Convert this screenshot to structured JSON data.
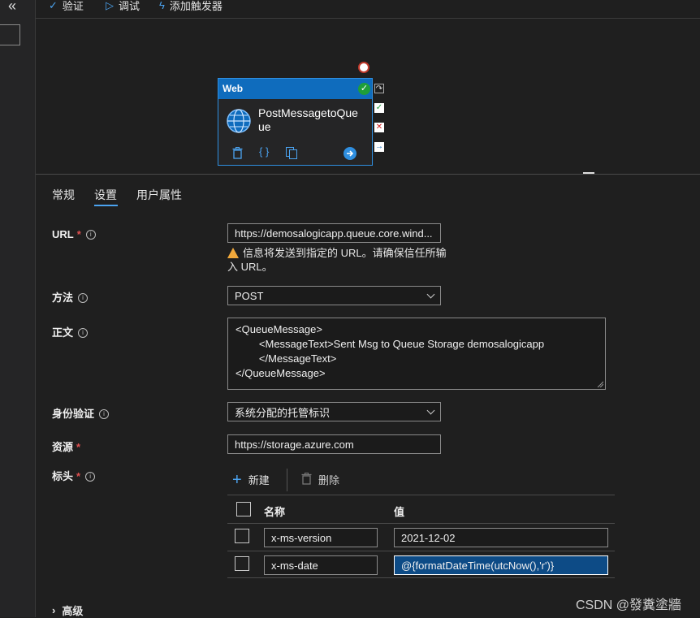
{
  "toolbar": {
    "validate": "验证",
    "debug": "调试",
    "add_trigger": "添加触发器"
  },
  "node": {
    "type": "Web",
    "title": "PostMessagetoQueue"
  },
  "tabs": [
    "常规",
    "设置",
    "用户属性"
  ],
  "form": {
    "url": {
      "label": "URL",
      "value": "https://demosalogicapp.queue.core.wind...",
      "warning": "信息将发送到指定的 URL。请确保信任所输入 URL。"
    },
    "method": {
      "label": "方法",
      "value": "POST"
    },
    "body": {
      "label": "正文",
      "lines": [
        "<QueueMessage>",
        "        <MessageText>Sent Msg to Queue Storage demosalogicapp",
        "        </MessageText>",
        "</QueueMessage>"
      ]
    },
    "auth": {
      "label": "身份验证",
      "value": "系统分配的托管标识"
    },
    "resource": {
      "label": "资源",
      "value": "https://storage.azure.com"
    },
    "headers": {
      "label": "标头",
      "new_button": "新建",
      "delete_button": "删除",
      "col_name": "名称",
      "col_value": "值",
      "rows": [
        {
          "name": "x-ms-version",
          "value": "2021-12-02"
        },
        {
          "name": "x-ms-date",
          "value": "@{formatDateTime(utcNow(),'r')}"
        }
      ]
    },
    "advanced": "高级"
  },
  "watermark": "CSDN @發糞塗牆",
  "colors": {
    "accent": "#0f6cbd",
    "background": "#1f1f1f",
    "required": "#e05050",
    "warning": "#f2a93b",
    "success": "#1e9e3a"
  }
}
